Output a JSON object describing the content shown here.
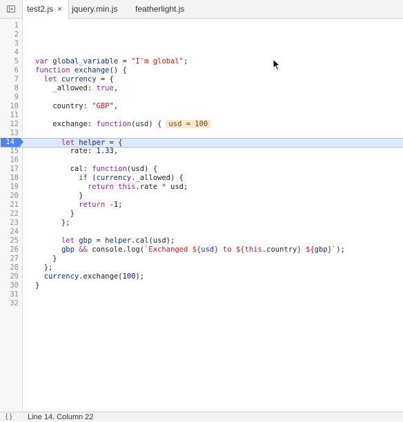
{
  "tabs": [
    {
      "label": "test2.js",
      "close": "×"
    },
    {
      "label": "jquery.min.js"
    },
    {
      "label": "featherlight.js"
    }
  ],
  "editor": {
    "current_line": 14,
    "lines": [
      {
        "n": "1",
        "segs": []
      },
      {
        "n": "2",
        "segs": []
      },
      {
        "n": "3",
        "segs": []
      },
      {
        "n": "4",
        "segs": []
      },
      {
        "n": "5",
        "segs": [
          [
            "kw",
            "var "
          ],
          [
            "ident",
            "global_variable"
          ],
          [
            "plain",
            " = "
          ],
          [
            "str",
            "\"I'm global\""
          ],
          [
            "plain",
            ";"
          ]
        ]
      },
      {
        "n": "6",
        "segs": [
          [
            "kw",
            "function "
          ],
          [
            "ident",
            "exchange"
          ],
          [
            "plain",
            "() {"
          ]
        ]
      },
      {
        "n": "7",
        "segs": [
          [
            "plain",
            "  "
          ],
          [
            "kw",
            "let "
          ],
          [
            "ident",
            "currency"
          ],
          [
            "plain",
            " = {"
          ]
        ]
      },
      {
        "n": "8",
        "segs": [
          [
            "plain",
            "    _allowed: "
          ],
          [
            "kw",
            "true"
          ],
          [
            "plain",
            ","
          ]
        ]
      },
      {
        "n": "9",
        "segs": []
      },
      {
        "n": "10",
        "segs": [
          [
            "plain",
            "    country: "
          ],
          [
            "str",
            "\"GBP\""
          ],
          [
            "plain",
            ","
          ]
        ]
      },
      {
        "n": "11",
        "segs": []
      },
      {
        "n": "12",
        "segs": [
          [
            "plain",
            "    exchange: "
          ],
          [
            "kw",
            "function"
          ],
          [
            "plain",
            "(usd) {"
          ]
        ],
        "inline": "usd = 100"
      },
      {
        "n": "13",
        "segs": []
      },
      {
        "n": "14",
        "segs": [
          [
            "plain",
            "      "
          ],
          [
            "kw",
            "let "
          ],
          [
            "ident",
            "helper"
          ],
          [
            "plain",
            " = {"
          ]
        ]
      },
      {
        "n": "15",
        "segs": [
          [
            "plain",
            "        rate: "
          ],
          [
            "num",
            "1.33"
          ],
          [
            "plain",
            ","
          ]
        ]
      },
      {
        "n": "16",
        "segs": []
      },
      {
        "n": "17",
        "segs": [
          [
            "plain",
            "        cal: "
          ],
          [
            "kw",
            "function"
          ],
          [
            "plain",
            "(usd) {"
          ]
        ]
      },
      {
        "n": "18",
        "segs": [
          [
            "plain",
            "          "
          ],
          [
            "kw",
            "if "
          ],
          [
            "plain",
            "("
          ],
          [
            "ident",
            "currency"
          ],
          [
            "plain",
            "._allowed) {"
          ]
        ]
      },
      {
        "n": "19",
        "segs": [
          [
            "plain",
            "            "
          ],
          [
            "kw",
            "return this"
          ],
          [
            "plain",
            ".rate "
          ],
          [
            "kw",
            "*"
          ],
          [
            "plain",
            " usd;"
          ]
        ]
      },
      {
        "n": "20",
        "segs": [
          [
            "plain",
            "          }"
          ]
        ]
      },
      {
        "n": "21",
        "segs": [
          [
            "plain",
            "          "
          ],
          [
            "kw",
            "return "
          ],
          [
            "num",
            "-1"
          ],
          [
            "plain",
            ";"
          ]
        ]
      },
      {
        "n": "22",
        "segs": [
          [
            "plain",
            "        }"
          ]
        ]
      },
      {
        "n": "23",
        "segs": [
          [
            "plain",
            "      };"
          ]
        ]
      },
      {
        "n": "24",
        "segs": []
      },
      {
        "n": "25",
        "segs": [
          [
            "plain",
            "      "
          ],
          [
            "kw",
            "let "
          ],
          [
            "ident",
            "gbp"
          ],
          [
            "plain",
            " = "
          ],
          [
            "ident",
            "helper"
          ],
          [
            "plain",
            ".cal(usd);"
          ]
        ]
      },
      {
        "n": "26",
        "segs": [
          [
            "plain",
            "      "
          ],
          [
            "ident",
            "gbp"
          ],
          [
            "plain",
            " "
          ],
          [
            "kw",
            "&&"
          ],
          [
            "plain",
            " console.log("
          ],
          [
            "str",
            "`Exchanged ${"
          ],
          [
            "ident",
            "usd"
          ],
          [
            "str",
            "} to ${"
          ],
          [
            "kw",
            "this"
          ],
          [
            "plain",
            ".country"
          ],
          [
            "str",
            "} ${"
          ],
          [
            "ident",
            "gbp"
          ],
          [
            "str",
            "}`"
          ],
          [
            "plain",
            ");"
          ]
        ]
      },
      {
        "n": "27",
        "segs": [
          [
            "plain",
            "    }"
          ]
        ]
      },
      {
        "n": "28",
        "segs": [
          [
            "plain",
            "  };"
          ]
        ]
      },
      {
        "n": "29",
        "segs": [
          [
            "plain",
            "  "
          ],
          [
            "ident",
            "currency"
          ],
          [
            "plain",
            ".exchange("
          ],
          [
            "num",
            "100"
          ],
          [
            "plain",
            ");"
          ]
        ]
      },
      {
        "n": "30",
        "segs": [
          [
            "plain",
            "}"
          ]
        ]
      },
      {
        "n": "31",
        "segs": []
      },
      {
        "n": "32",
        "segs": []
      }
    ]
  },
  "status": {
    "icon": "{ }",
    "text": "Line 14, Column 22"
  },
  "icons": {
    "navigator_toggle": "navigator-toggle-icon",
    "pointer": "mouse-pointer-icon"
  }
}
